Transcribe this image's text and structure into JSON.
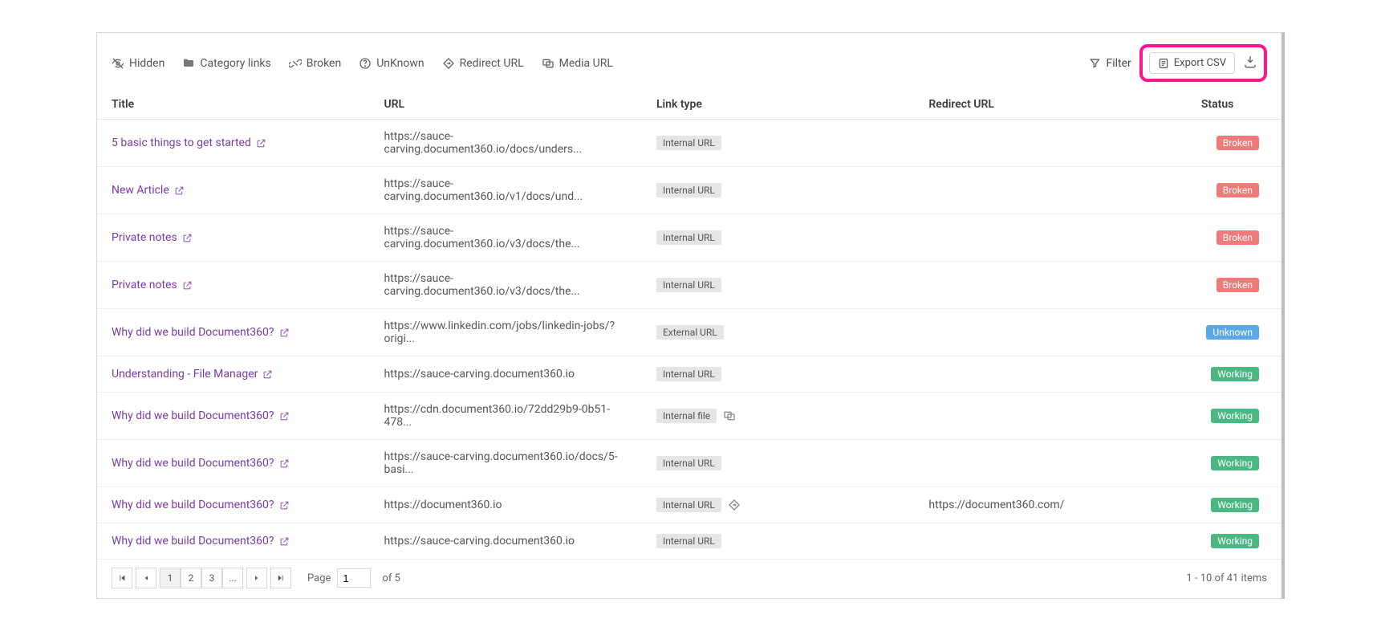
{
  "legend": {
    "hidden": "Hidden",
    "category": "Category links",
    "broken": "Broken",
    "unknown": "UnKnown",
    "redirect": "Redirect URL",
    "media": "Media URL"
  },
  "actions": {
    "filter": "Filter",
    "export": "Export CSV"
  },
  "columns": {
    "title": "Title",
    "url": "URL",
    "linktype": "Link type",
    "redirect": "Redirect URL",
    "status": "Status"
  },
  "rows": [
    {
      "title": "5 basic things to get started",
      "url": "https://sauce-carving.document360.io/docs/unders...",
      "type": "Internal URL",
      "mediaIcon": false,
      "redirectIcon": false,
      "redirect": "",
      "status": "Broken",
      "statusClass": "broken"
    },
    {
      "title": "New Article",
      "url": "https://sauce-carving.document360.io/v1/docs/und...",
      "type": "Internal URL",
      "mediaIcon": false,
      "redirectIcon": false,
      "redirect": "",
      "status": "Broken",
      "statusClass": "broken"
    },
    {
      "title": "Private notes",
      "url": "https://sauce-carving.document360.io/v3/docs/the...",
      "type": "Internal URL",
      "mediaIcon": false,
      "redirectIcon": false,
      "redirect": "",
      "status": "Broken",
      "statusClass": "broken"
    },
    {
      "title": "Private notes",
      "url": "https://sauce-carving.document360.io/v3/docs/the...",
      "type": "Internal URL",
      "mediaIcon": false,
      "redirectIcon": false,
      "redirect": "",
      "status": "Broken",
      "statusClass": "broken"
    },
    {
      "title": "Why did we build Document360?",
      "url": "https://www.linkedin.com/jobs/linkedin-jobs/?origi...",
      "type": "External URL",
      "mediaIcon": false,
      "redirectIcon": false,
      "redirect": "",
      "status": "Unknown",
      "statusClass": "unknown"
    },
    {
      "title": "Understanding - File Manager",
      "url": "https://sauce-carving.document360.io",
      "type": "Internal URL",
      "mediaIcon": false,
      "redirectIcon": false,
      "redirect": "",
      "status": "Working",
      "statusClass": "working"
    },
    {
      "title": "Why did we build Document360?",
      "url": "https://cdn.document360.io/72dd29b9-0b51-478...",
      "type": "Internal file",
      "mediaIcon": true,
      "redirectIcon": false,
      "redirect": "",
      "status": "Working",
      "statusClass": "working"
    },
    {
      "title": "Why did we build Document360?",
      "url": "https://sauce-carving.document360.io/docs/5-basi...",
      "type": "Internal URL",
      "mediaIcon": false,
      "redirectIcon": false,
      "redirect": "",
      "status": "Working",
      "statusClass": "working"
    },
    {
      "title": "Why did we build Document360?",
      "url": "https://document360.io",
      "type": "Internal URL",
      "mediaIcon": false,
      "redirectIcon": true,
      "redirect": "https://document360.com/",
      "status": "Working",
      "statusClass": "working"
    },
    {
      "title": "Why did we build Document360?",
      "url": "https://sauce-carving.document360.io",
      "type": "Internal URL",
      "mediaIcon": false,
      "redirectIcon": false,
      "redirect": "",
      "status": "Working",
      "statusClass": "working"
    }
  ],
  "pagination": {
    "pages": [
      "1",
      "2",
      "3",
      "..."
    ],
    "activeIndex": 0,
    "pageLabel": "Page",
    "pageInput": "1",
    "ofText": "of 5",
    "summary": "1 - 10 of 41 items"
  }
}
